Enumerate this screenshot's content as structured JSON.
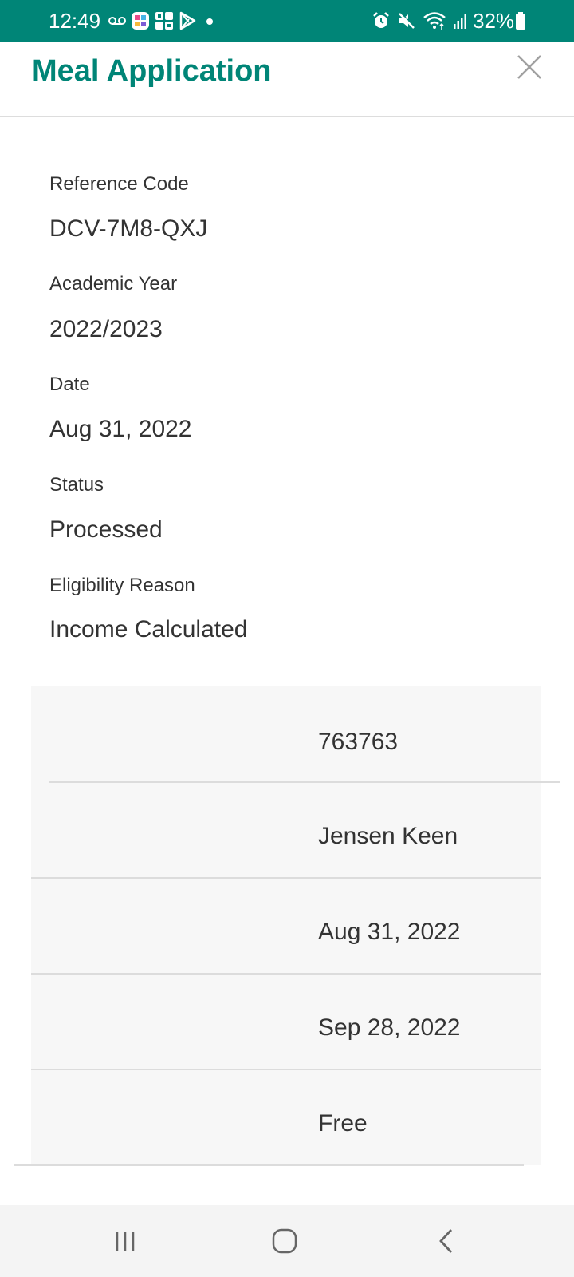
{
  "status_bar": {
    "time": "12:49",
    "battery": "32%",
    "left_icons": [
      "voicemail-icon",
      "app-icon",
      "app-icon",
      "play-store-icon",
      "notification-dot-icon"
    ],
    "right_icons": [
      "alarm-icon",
      "mute-icon",
      "wifi-icon",
      "signal-icon",
      "battery-icon"
    ],
    "background": "#008577"
  },
  "header": {
    "title": "Meal Application",
    "close_icon": "close-icon",
    "accent_color": "#008577"
  },
  "fields": [
    {
      "label": "Reference Code",
      "value": "DCV-7M8-QXJ"
    },
    {
      "label": "Academic Year",
      "value": "2022/2023"
    },
    {
      "label": "Date",
      "value": "Aug 31, 2022"
    },
    {
      "label": "Status",
      "value": "Processed"
    },
    {
      "label": "Eligibility Reason",
      "value": "Income Calculated"
    }
  ],
  "detail_rows": [
    "763763",
    "Jensen Keen",
    "Aug 31, 2022",
    "Sep 28, 2022",
    "Free"
  ],
  "nav_bar": {
    "buttons": [
      "recent-apps-icon",
      "home-icon",
      "back-icon"
    ]
  }
}
